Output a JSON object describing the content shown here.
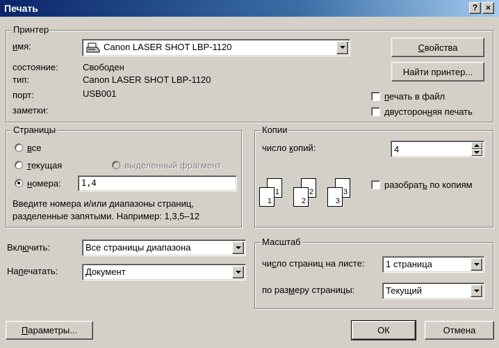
{
  "window": {
    "title": "Печать",
    "help_label": "?",
    "close_label": "×"
  },
  "printer": {
    "legend": "Принтер",
    "name_label_u": "и",
    "name_label_rest": "мя:",
    "selected": "Canon LASER SHOT LBP-1120",
    "status_label": "состояние:",
    "status_value": "Свободен",
    "type_label": "тип:",
    "type_value": "Canon LASER SHOT LBP-1120",
    "port_label": "порт:",
    "port_value": "USB001",
    "notes_label": "заметки:",
    "notes_value": "",
    "properties_u": "С",
    "properties_rest": "войства",
    "find_label": "Найти принтер...",
    "print_to_file_u": "п",
    "print_to_file_rest": "ечать в файл",
    "duplex_pre": "двусторон",
    "duplex_u": "н",
    "duplex_rest": "яя печать"
  },
  "pages": {
    "legend": "Страницы",
    "all_u": "в",
    "all_rest": "се",
    "current_u": "т",
    "current_rest": "екущая",
    "selection_label": "выделенный фрагмент",
    "numbers_u": "н",
    "numbers_rest": "омера:",
    "numbers_value": "1,4",
    "hint_line1": "Введите номера и/или диапазоны страниц,",
    "hint_line2": "разделенные запятыми. Например: 1,3,5–12",
    "selected_option": "numbers"
  },
  "copies": {
    "legend": "Копии",
    "count_pre": "число ",
    "count_u": "к",
    "count_rest": "опий:",
    "count_value": "4",
    "collate_pre": "разобрат",
    "collate_u": "ь",
    "collate_rest": " по копиям",
    "collate_checked": false,
    "sheets": [
      {
        "back": "1",
        "front": "1"
      },
      {
        "back": "2",
        "front": "2"
      },
      {
        "back": "3",
        "front": "3"
      }
    ]
  },
  "include": {
    "label_pre": "Вкл",
    "label_u": "ю",
    "label_rest": "чить:",
    "value": "Все страницы диапазона"
  },
  "print_what": {
    "label_pre": "На",
    "label_u": "п",
    "label_rest": "ечатать:",
    "value": "Документ"
  },
  "scale": {
    "legend": "Масштаб",
    "pages_per_sheet_pre": "чи",
    "pages_per_sheet_u": "с",
    "pages_per_sheet_rest": "ло страниц на листе:",
    "pages_per_sheet_value": "1 страница",
    "fit_pre": "по раз",
    "fit_u": "м",
    "fit_rest": "еру страницы:",
    "fit_value": "Текущий"
  },
  "footer": {
    "options_u": "П",
    "options_rest": "араметры...",
    "ok_label": "ОК",
    "cancel_label": "Отмена"
  }
}
